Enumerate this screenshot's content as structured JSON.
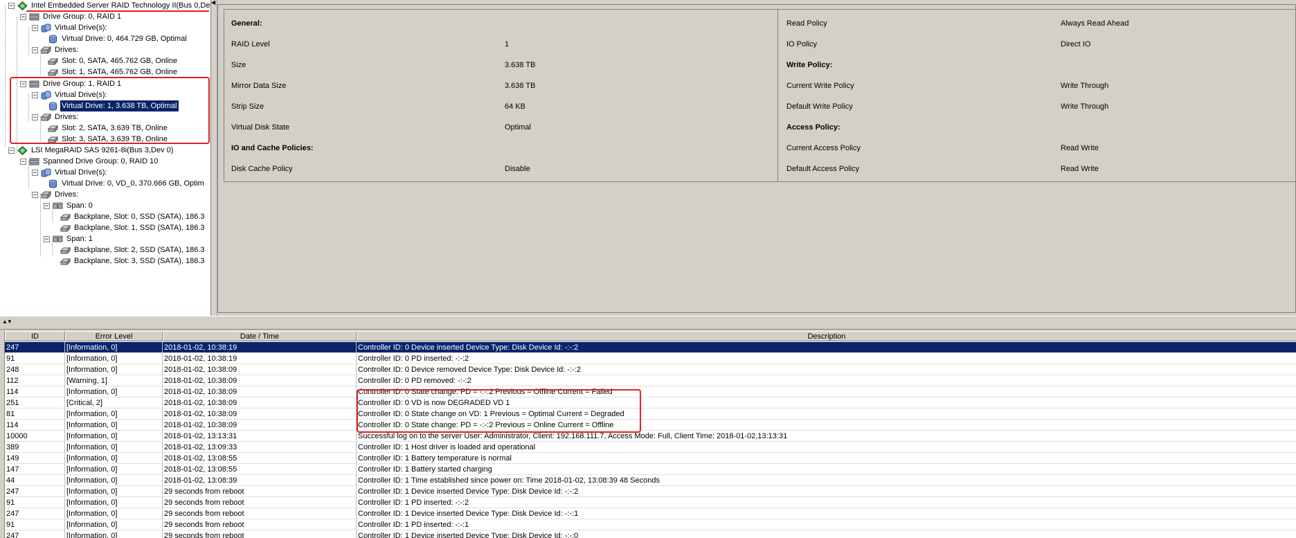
{
  "tree": {
    "nodes": [
      {
        "label": "Intel Embedded Server RAID Technology II(Bus 0,Dev",
        "icon": "controller-icon"
      },
      {
        "label": "Drive Group: 0, RAID  1",
        "icon": "drive-group-icon"
      },
      {
        "label": "Virtual Drive(s):",
        "icon": "virtual-drives-icon"
      },
      {
        "label": "Virtual Drive: 0, 464.729 GB, Optimal",
        "icon": "virtual-drive-icon"
      },
      {
        "label": "Drives:",
        "icon": "drives-icon"
      },
      {
        "label": "Slot: 0, SATA, 465.762 GB, Online",
        "icon": "physical-drive-icon"
      },
      {
        "label": "Slot: 1, SATA, 465.762 GB, Online",
        "icon": "physical-drive-icon"
      },
      {
        "label": "Drive Group: 1, RAID  1",
        "icon": "drive-group-icon"
      },
      {
        "label": "Virtual Drive(s):",
        "icon": "virtual-drives-icon"
      },
      {
        "label": "Virtual Drive: 1, 3.638 TB, Optimal",
        "icon": "virtual-drive-icon"
      },
      {
        "label": "Drives:",
        "icon": "drives-icon"
      },
      {
        "label": "Slot: 2, SATA, 3.639 TB, Online",
        "icon": "physical-drive-icon"
      },
      {
        "label": "Slot: 3, SATA, 3.639 TB, Online",
        "icon": "physical-drive-icon"
      },
      {
        "label": "LSI MegaRAID SAS 9261-8i(Bus 3,Dev 0)",
        "icon": "controller-icon"
      },
      {
        "label": "Spanned Drive Group: 0, RAID  10",
        "icon": "drive-group-icon"
      },
      {
        "label": "Virtual Drive(s):",
        "icon": "virtual-drives-icon"
      },
      {
        "label": "Virtual Drive: 0, VD_0, 370.666 GB, Optim",
        "icon": "virtual-drive-icon"
      },
      {
        "label": "Drives:",
        "icon": "drives-icon"
      },
      {
        "label": "Span: 0",
        "icon": "span-icon"
      },
      {
        "label": "Backplane, Slot: 0, SSD (SATA), 186.3",
        "icon": "physical-drive-icon"
      },
      {
        "label": "Backplane, Slot: 1, SSD (SATA), 186.3",
        "icon": "physical-drive-icon"
      },
      {
        "label": "Span: 1",
        "icon": "span-icon"
      },
      {
        "label": "Backplane, Slot: 2, SSD (SATA), 186.3",
        "icon": "physical-drive-icon"
      },
      {
        "label": "Backplane, Slot: 3, SSD (SATA), 186.3",
        "icon": "physical-drive-icon"
      }
    ]
  },
  "properties": {
    "left": [
      {
        "label": "General:",
        "value": ""
      },
      {
        "label": "RAID Level",
        "value": "1"
      },
      {
        "label": "Size",
        "value": "3.638 TB"
      },
      {
        "label": "Mirror Data Size",
        "value": "3.638 TB"
      },
      {
        "label": "Strip Size",
        "value": "64 KB"
      },
      {
        "label": "Virtual Disk State",
        "value": "Optimal"
      },
      {
        "label": "IO and Cache Policies:",
        "value": ""
      },
      {
        "label": "Disk Cache Policy",
        "value": "Disable"
      }
    ],
    "right": [
      {
        "label": "Read Policy",
        "value": "Always Read Ahead"
      },
      {
        "label": "IO Policy",
        "value": "Direct IO"
      },
      {
        "label": "Write Policy:",
        "value": ""
      },
      {
        "label": "Current Write Policy",
        "value": "Write Through"
      },
      {
        "label": "Default Write Policy",
        "value": "Write Through"
      },
      {
        "label": "Access Policy:",
        "value": ""
      },
      {
        "label": "Current Access Policy",
        "value": "Read Write"
      },
      {
        "label": "Default Access Policy",
        "value": "Read Write"
      }
    ]
  },
  "log": {
    "columns": [
      "ID",
      "Error Level",
      "Date / Time",
      "Description"
    ],
    "rows": [
      [
        "247",
        "[Information, 0]",
        "2018-01-02, 10:38:19",
        "Controller ID: 0 Device inserted Device Type: Disk Device Id: -:-:2"
      ],
      [
        "91",
        "[Information, 0]",
        "2018-01-02, 10:38:19",
        "Controller ID: 0 PD inserted: -:-:2"
      ],
      [
        "248",
        "[Information, 0]",
        "2018-01-02, 10:38:09",
        "Controller ID: 0 Device removed Device Type: Disk Device Id: -:-:2"
      ],
      [
        "112",
        "[Warning, 1]",
        "2018-01-02, 10:38:09",
        "Controller ID: 0 PD removed: -:-:2"
      ],
      [
        "114",
        "[Information, 0]",
        "2018-01-02, 10:38:09",
        "Controller ID: 0 State change: PD = -:-:2 Previous = Offline Current = Failed"
      ],
      [
        "251",
        "[Critical, 2]",
        "2018-01-02, 10:38:09",
        "Controller ID: 0 VD is now DEGRADED VD 1"
      ],
      [
        "81",
        "[Information, 0]",
        "2018-01-02, 10:38:09",
        "Controller ID: 0 State change on VD: 1 Previous = Optimal Current = Degraded"
      ],
      [
        "114",
        "[Information, 0]",
        "2018-01-02, 10:38:09",
        "Controller ID: 0 State change: PD = -:-:2 Previous = Online Current = Offline"
      ],
      [
        "10000",
        "[Information, 0]",
        "2018-01-02, 13:13:31",
        "Successful log on to the server User:  Administrator, Client:  192.168.111.7,    Access Mode:  Full, Client Time:  2018-01-02,13:13:31"
      ],
      [
        "389",
        "[Information, 0]",
        "2018-01-02, 13:09:33",
        "Controller ID:  1  Host driver is loaded and operational"
      ],
      [
        "149",
        "[Information, 0]",
        "2018-01-02, 13:08:55",
        "Controller ID:  1  Battery temperature is normal"
      ],
      [
        "147",
        "[Information, 0]",
        "2018-01-02, 13:08:55",
        "Controller ID:  1  Battery started charging"
      ],
      [
        "44",
        "[Information, 0]",
        "2018-01-02, 13:08:39",
        "Controller ID:  1  Time established since power on:  Time  2018-01-02, 13:08:39     48  Seconds"
      ],
      [
        "247",
        "[Information, 0]",
        "29  seconds from reboot",
        "Controller ID:  1  Device inserted  Device Type:     Disk  Device Id:   -:-:2"
      ],
      [
        "91",
        "[Information, 0]",
        "29  seconds from reboot",
        "Controller ID:  1  PD inserted:      -:-:2"
      ],
      [
        "247",
        "[Information, 0]",
        "29  seconds from reboot",
        "Controller ID:  1  Device inserted  Device Type:     Disk  Device Id:   -:-:1"
      ],
      [
        "91",
        "[Information, 0]",
        "29  seconds from reboot",
        "Controller ID:  1  PD inserted:      -:-:1"
      ],
      [
        "247",
        "[Information, 0]",
        "29  seconds from reboot",
        "Controller ID:  1  Device inserted  Device Type:     Disk  Device Id:   -:-:0"
      ]
    ]
  }
}
